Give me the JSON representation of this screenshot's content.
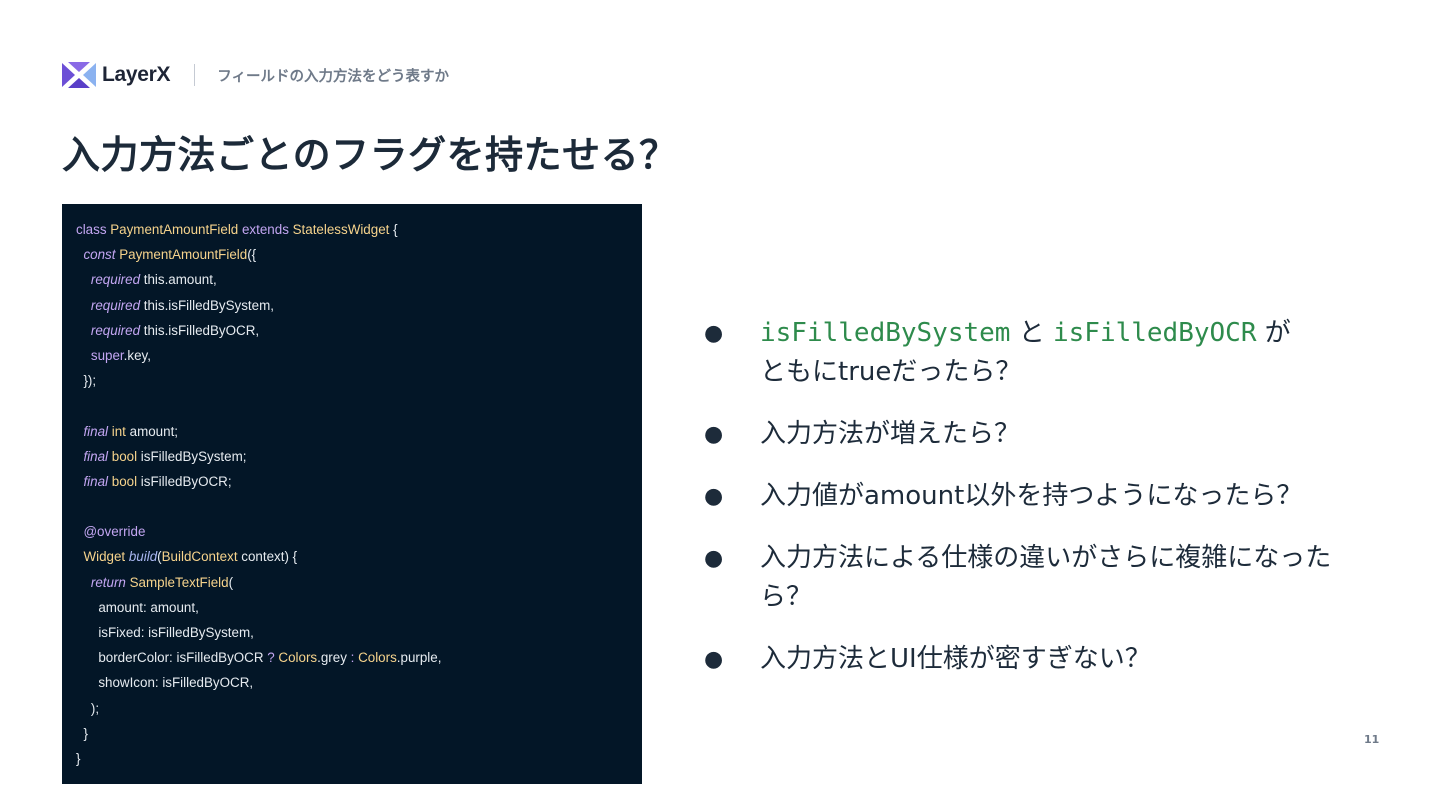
{
  "colors": {
    "accent_purple": "#6c4fd6",
    "accent_blue": "#8bb2f0",
    "code_background": "#031627",
    "code_keyword": "#c3a6f2",
    "code_type": "#f6d38c",
    "mono_green": "#2e8b4c"
  },
  "header": {
    "logo_icon": "layerx-logo-icon",
    "logo_text": "LayerX",
    "section": "フィールドの入力方法をどう表すか"
  },
  "title": "入力方法ごとのフラグを持たせる？",
  "code": {
    "lines": [
      [
        {
          "t": "class ",
          "c": "kw"
        },
        {
          "t": "PaymentAmountField ",
          "c": "ty"
        },
        {
          "t": "extends ",
          "c": "kw"
        },
        {
          "t": "StatelessWidget ",
          "c": "ty"
        },
        {
          "t": "{"
        }
      ],
      [
        {
          "t": "  "
        },
        {
          "t": "const ",
          "c": "it"
        },
        {
          "t": "PaymentAmountField",
          "c": "ty"
        },
        {
          "t": "({"
        }
      ],
      [
        {
          "t": "    "
        },
        {
          "t": "required ",
          "c": "it"
        },
        {
          "t": "this.amount,"
        }
      ],
      [
        {
          "t": "    "
        },
        {
          "t": "required ",
          "c": "it"
        },
        {
          "t": "this.isFilledBySystem,"
        }
      ],
      [
        {
          "t": "    "
        },
        {
          "t": "required ",
          "c": "it"
        },
        {
          "t": "this.isFilledByOCR,"
        }
      ],
      [
        {
          "t": "    "
        },
        {
          "t": "super",
          "c": "kw"
        },
        {
          "t": ".key,"
        }
      ],
      [
        {
          "t": "  });"
        }
      ],
      [
        {
          "t": ""
        }
      ],
      [
        {
          "t": "  "
        },
        {
          "t": "final ",
          "c": "it"
        },
        {
          "t": "int ",
          "c": "ty"
        },
        {
          "t": "amount;"
        }
      ],
      [
        {
          "t": "  "
        },
        {
          "t": "final ",
          "c": "it"
        },
        {
          "t": "bool ",
          "c": "ty"
        },
        {
          "t": "isFilledBySystem;"
        }
      ],
      [
        {
          "t": "  "
        },
        {
          "t": "final ",
          "c": "it"
        },
        {
          "t": "bool ",
          "c": "ty"
        },
        {
          "t": "isFilledByOCR;"
        }
      ],
      [
        {
          "t": ""
        }
      ],
      [
        {
          "t": "  "
        },
        {
          "t": "@override",
          "c": "kw"
        }
      ],
      [
        {
          "t": "  "
        },
        {
          "t": "Widget ",
          "c": "ty"
        },
        {
          "t": "build",
          "c": "fn"
        },
        {
          "t": "("
        },
        {
          "t": "BuildContext ",
          "c": "ty"
        },
        {
          "t": "context) {"
        }
      ],
      [
        {
          "t": "    "
        },
        {
          "t": "return ",
          "c": "it"
        },
        {
          "t": "SampleTextField",
          "c": "ty"
        },
        {
          "t": "("
        }
      ],
      [
        {
          "t": "      amount: amount,"
        }
      ],
      [
        {
          "t": "      isFixed: isFilledBySystem,"
        }
      ],
      [
        {
          "t": "      borderColor: isFilledByOCR "
        },
        {
          "t": "? ",
          "c": "kw"
        },
        {
          "t": "Colors",
          "c": "ty"
        },
        {
          "t": ".grey "
        },
        {
          "t": ": ",
          "c": "kw"
        },
        {
          "t": "Colors",
          "c": "ty"
        },
        {
          "t": ".purple,"
        }
      ],
      [
        {
          "t": "      showIcon: isFilledByOCR,"
        }
      ],
      [
        {
          "t": "    );"
        }
      ],
      [
        {
          "t": "  }"
        }
      ],
      [
        {
          "t": "}"
        }
      ]
    ]
  },
  "bullets": [
    [
      {
        "t": "isFilledBySystem",
        "mono": true
      },
      {
        "t": " と "
      },
      {
        "t": "isFilledByOCR",
        "mono": true
      },
      {
        "t": " が"
      },
      {
        "br": true
      },
      {
        "t": "ともにtrueだったら？"
      }
    ],
    [
      {
        "t": "入力方法が増えたら？"
      }
    ],
    [
      {
        "t": "入力値がamount以外を持つようになったら？"
      }
    ],
    [
      {
        "t": "入力方法による仕様の違いがさらに複雑になった"
      },
      {
        "br": true
      },
      {
        "t": "ら？"
      }
    ],
    [
      {
        "t": "入力方法とUI仕様が密すぎない？"
      }
    ]
  ],
  "bullet_marker": "●",
  "page_number": "11"
}
